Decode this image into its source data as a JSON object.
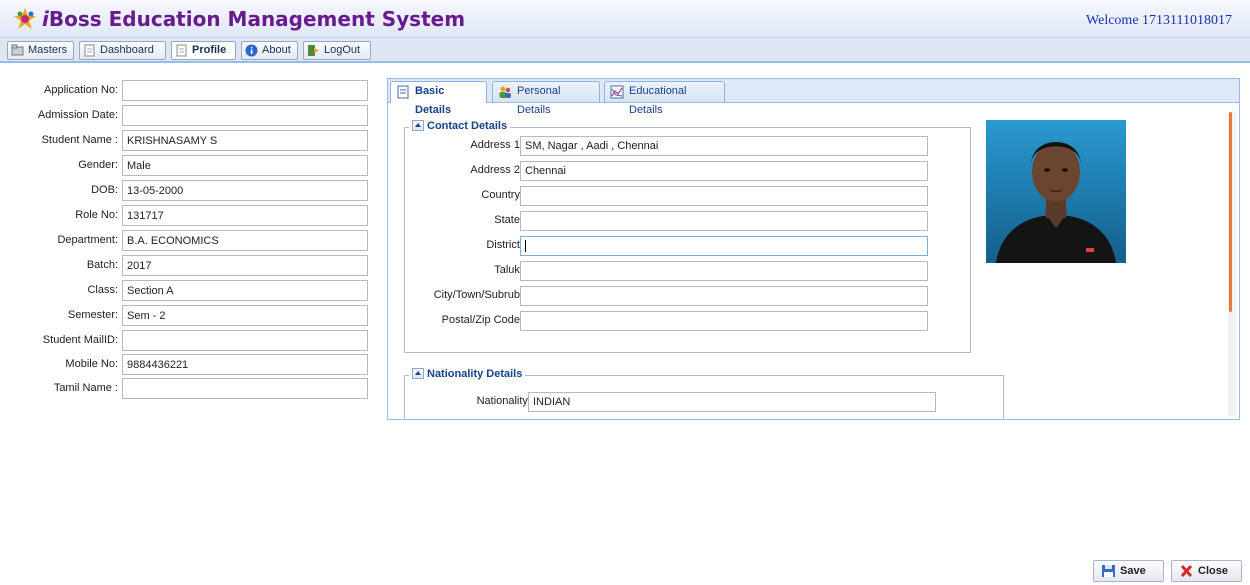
{
  "app": {
    "title_prefix": "i",
    "title_rest": "Boss Education Management System",
    "welcome": "Welcome 1713111018017"
  },
  "menu": [
    {
      "label": "Masters",
      "icon": "folder-icon"
    },
    {
      "label": "Dashboard",
      "icon": "page-icon"
    },
    {
      "label": "Profile",
      "icon": "page-icon",
      "active": true
    },
    {
      "label": "About",
      "icon": "info-icon"
    },
    {
      "label": "LogOut",
      "icon": "logout-icon"
    }
  ],
  "student": {
    "fields": [
      {
        "label": "Application No:",
        "value": ""
      },
      {
        "label": "Admission Date:",
        "value": ""
      },
      {
        "label": "Student Name :",
        "value": "KRISHNASAMY S"
      },
      {
        "label": "Gender:",
        "value": "Male"
      },
      {
        "label": "DOB:",
        "value": "13-05-2000"
      },
      {
        "label": "Role No:",
        "value": "131717"
      },
      {
        "label": "Department:",
        "value": "B.A. ECONOMICS"
      },
      {
        "label": "Batch:",
        "value": "2017"
      },
      {
        "label": "Class:",
        "value": "Section A"
      },
      {
        "label": "Semester:",
        "value": "Sem - 2"
      },
      {
        "label": "Student MailID:",
        "value": ""
      },
      {
        "label": "Mobile No:",
        "value": "9884436221"
      },
      {
        "label": "Tamil Name :",
        "value": ""
      }
    ]
  },
  "tabs": [
    {
      "label": "Basic Details",
      "active": true
    },
    {
      "label": "Personal Details"
    },
    {
      "label": "Educational Details"
    }
  ],
  "contact": {
    "legend": "Contact Details",
    "fields": [
      {
        "label": "Address 1:",
        "value": "SM, Nagar , Aadi , Chennai"
      },
      {
        "label": "Address 2:",
        "value": "Chennai"
      },
      {
        "label": "Country:",
        "value": ""
      },
      {
        "label": "State:",
        "value": ""
      },
      {
        "label": "District:",
        "value": ""
      },
      {
        "label": "Taluk:",
        "value": ""
      },
      {
        "label": "City/Town/Subrub:",
        "value": ""
      },
      {
        "label": "Postal/Zip Code:",
        "value": ""
      }
    ]
  },
  "nationality": {
    "legend": "Nationality Details",
    "fields": [
      {
        "label": "Nationality:",
        "value": "INDIAN"
      }
    ]
  },
  "buttons": {
    "save": "Save",
    "close": "Close"
  },
  "colors": {
    "brand": "#6a1a8f",
    "welcome": "#1a2fb0",
    "tab_text": "#15428b",
    "scroll_thumb": "#e87b3c"
  }
}
